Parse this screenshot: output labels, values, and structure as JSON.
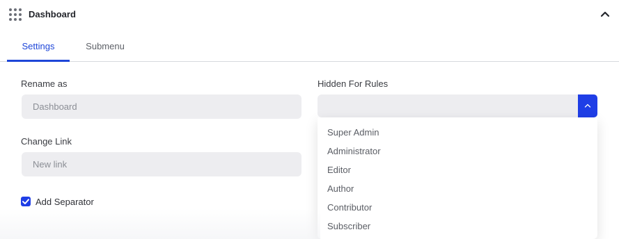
{
  "header": {
    "title": "Dashboard",
    "drag_icon": "grip-dots-icon",
    "collapse_icon": "chevron-up-icon"
  },
  "tabs": [
    {
      "label": "Settings",
      "active": true
    },
    {
      "label": "Submenu",
      "active": false
    }
  ],
  "form": {
    "rename": {
      "label": "Rename as",
      "placeholder": "Dashboard"
    },
    "link": {
      "label": "Change Link",
      "placeholder": "New link"
    },
    "separator": {
      "label": "Add Separator",
      "checked": true
    },
    "hidden_rules": {
      "label": "Hidden For Rules",
      "value": "",
      "options": [
        "Super Admin",
        "Administrator",
        "Editor",
        "Author",
        "Contributor",
        "Subscriber"
      ]
    }
  },
  "colors": {
    "accent": "#1f3ee6",
    "input_bg": "#ededf0"
  }
}
